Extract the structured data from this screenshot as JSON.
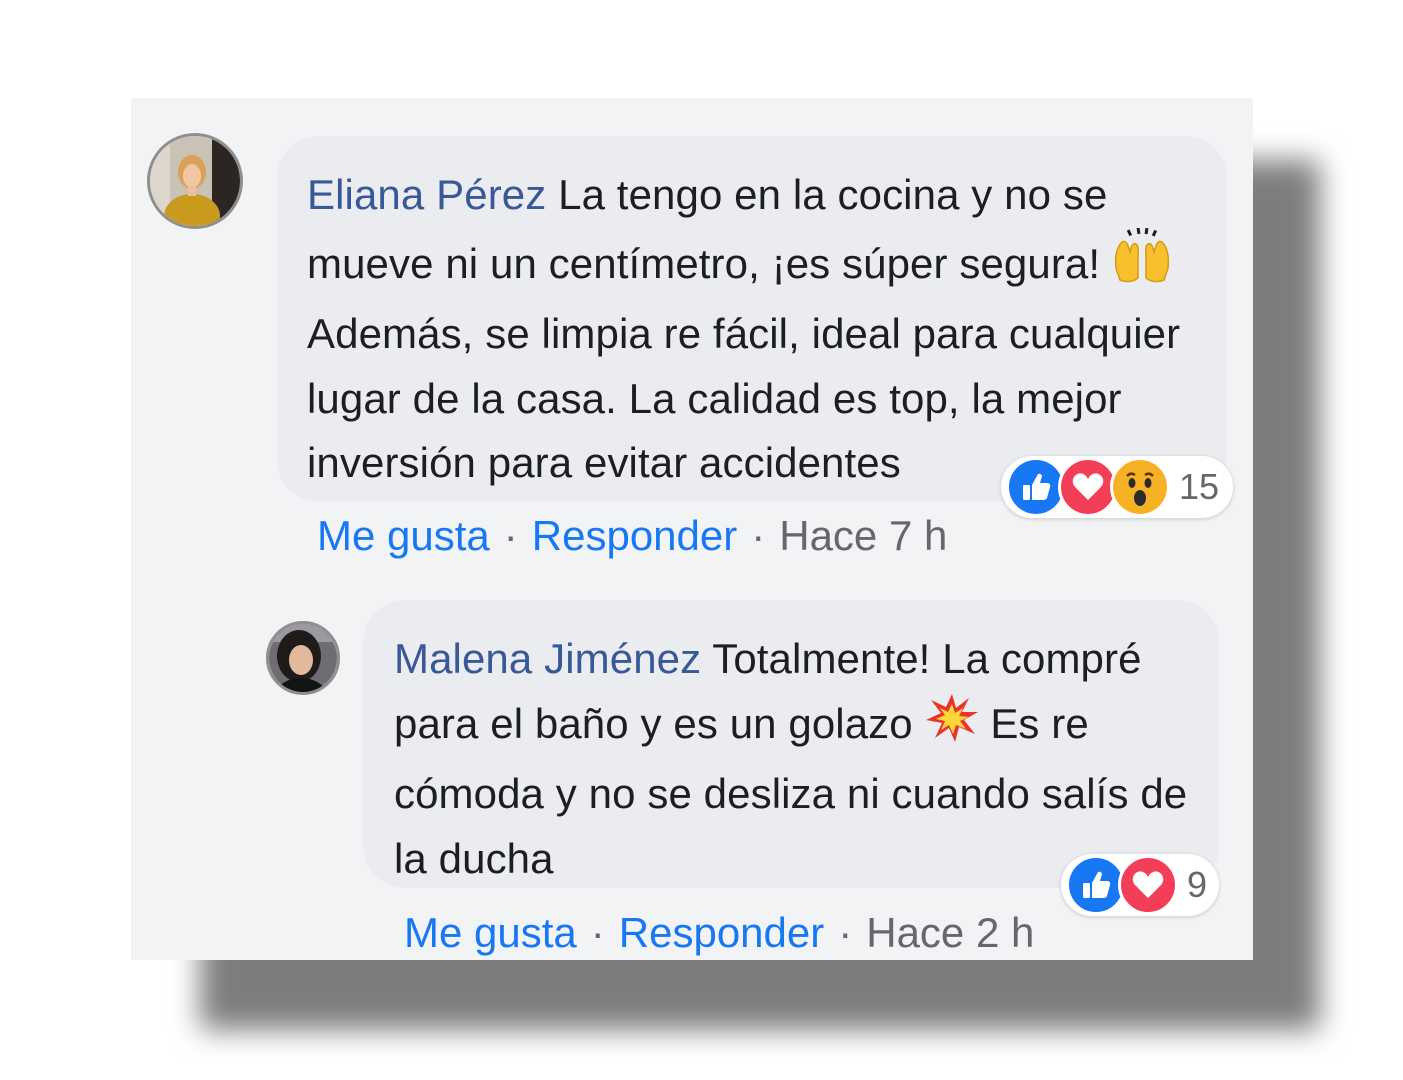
{
  "comments": [
    {
      "author": "Eliana Pérez",
      "text_part1": "La tengo en la cocina y no se mueve ni un centímetro, ¡es súper segura!",
      "text_part2": "Además, se limpia re fácil, ideal para cualquier lugar de la casa. La calidad es top, la mejor inversión para evitar accidentes",
      "emoji": "raising-hands-icon",
      "like_label": "Me gusta",
      "reply_label": "Responder",
      "timestamp": "Hace 7 h",
      "separator": "·",
      "reaction_count": "15",
      "reactions": [
        "like-icon",
        "love-icon",
        "wow-icon"
      ]
    },
    {
      "author": "Malena Jiménez",
      "text_part1": "Totalmente! La compré para el baño y es un golazo",
      "text_part2": "Es re cómoda y no se desliza ni cuando salís de la ducha",
      "emoji": "collision-icon",
      "like_label": "Me gusta",
      "reply_label": "Responder",
      "timestamp": "Hace 2 h",
      "separator": "·",
      "reaction_count": "9",
      "reactions": [
        "like-icon",
        "love-icon"
      ]
    }
  ],
  "colors": {
    "author": "#385898",
    "link": "#1877f2",
    "meta": "#65676b",
    "bubble": "#eaecef",
    "card": "#f2f3f5",
    "like": "#1877f2",
    "love": "#f33e58",
    "wow": "#f7b125"
  }
}
